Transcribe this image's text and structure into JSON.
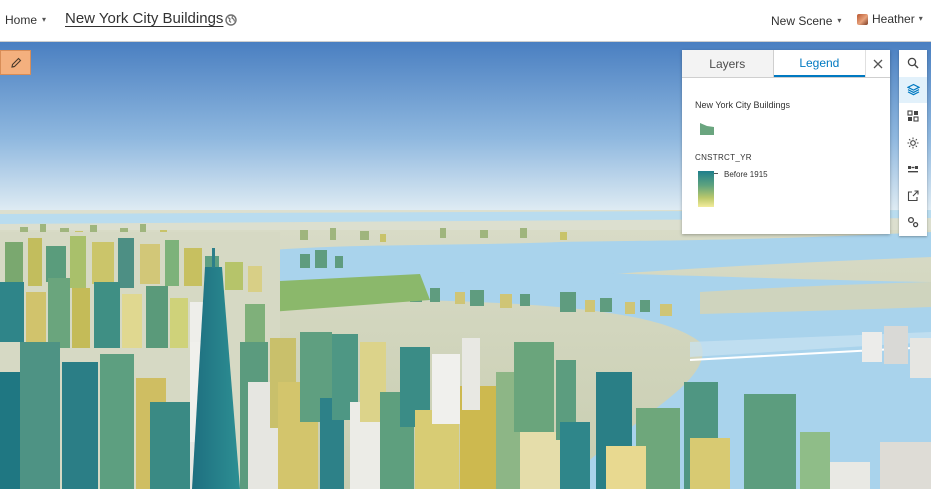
{
  "header": {
    "home_label": "Home",
    "title": "New York City Buildings",
    "scene_menu_label": "New Scene",
    "user_name": "Heather"
  },
  "legend_panel": {
    "tabs": [
      {
        "label": "Layers",
        "active": false
      },
      {
        "label": "Legend",
        "active": true
      }
    ],
    "layer_title": "New York City Buildings",
    "field_label": "CNSTRCT_YR",
    "ramp_label": "Before 1915",
    "ramp_colors": [
      "#1f7f8c",
      "#5ea37e",
      "#bcc96b",
      "#f2ec9c"
    ]
  },
  "toolbar": {
    "tools": [
      {
        "name": "search-icon",
        "active": false
      },
      {
        "name": "layers-icon",
        "active": true
      },
      {
        "name": "basemap-gallery-icon",
        "active": false
      },
      {
        "name": "daylight-icon",
        "active": false
      },
      {
        "name": "slides-icon",
        "active": false
      },
      {
        "name": "share-icon",
        "active": false
      },
      {
        "name": "settings-icon",
        "active": false
      }
    ]
  },
  "colors": {
    "accent": "#0079c1",
    "edit_button": "#f4b07e",
    "sky_top": "#4a7fc1",
    "sky_horizon": "#e6f0f5",
    "water": "#a9d3ec"
  }
}
